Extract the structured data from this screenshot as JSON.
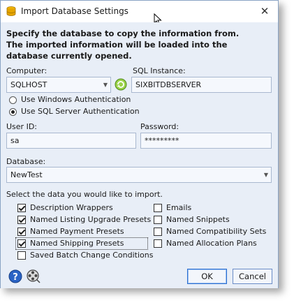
{
  "window": {
    "title": "Import Database Settings"
  },
  "intro": {
    "line1": "Specify the database to copy the information from.",
    "line2": "The imported information will be loaded into the",
    "line3": "database currently opened."
  },
  "computer": {
    "label": "Computer:",
    "value": "SQLHOST"
  },
  "sql_instance": {
    "label": "SQL Instance:",
    "value": "SIXBITDBSERVER"
  },
  "auth": {
    "windows_label": "Use Windows Authentication",
    "sql_label": "Use SQL Server Authentication",
    "selected": "sql"
  },
  "user_id": {
    "label": "User ID:",
    "value": "sa"
  },
  "password": {
    "label": "Password:",
    "value": "*********"
  },
  "database": {
    "label": "Database:",
    "value": "NewTest"
  },
  "select_prompt": "Select the data you would like to import.",
  "import_options": {
    "description_wrappers": {
      "label": "Description Wrappers",
      "checked": true
    },
    "listing_upgrade_presets": {
      "label": "Named Listing Upgrade Presets",
      "checked": true
    },
    "payment_presets": {
      "label": "Named Payment Presets",
      "checked": true
    },
    "shipping_presets": {
      "label": "Named Shipping Presets",
      "checked": true
    },
    "saved_batch_change": {
      "label": "Saved Batch Change Conditions",
      "checked": false
    },
    "emails": {
      "label": "Emails",
      "checked": false
    },
    "snippets": {
      "label": "Named Snippets",
      "checked": false
    },
    "compatibility_sets": {
      "label": "Named Compatibility Sets",
      "checked": false
    },
    "allocation_plans": {
      "label": "Named Allocation Plans",
      "checked": false
    }
  },
  "buttons": {
    "ok": "OK",
    "cancel": "Cancel"
  },
  "icons": {
    "app": "database-icon",
    "close": "close-icon",
    "refresh": "refresh-icon",
    "help": "help-icon",
    "video": "film-reel-icon"
  },
  "colors": {
    "content_bg": "#e8eef7",
    "accent": "#2c6fd1"
  }
}
